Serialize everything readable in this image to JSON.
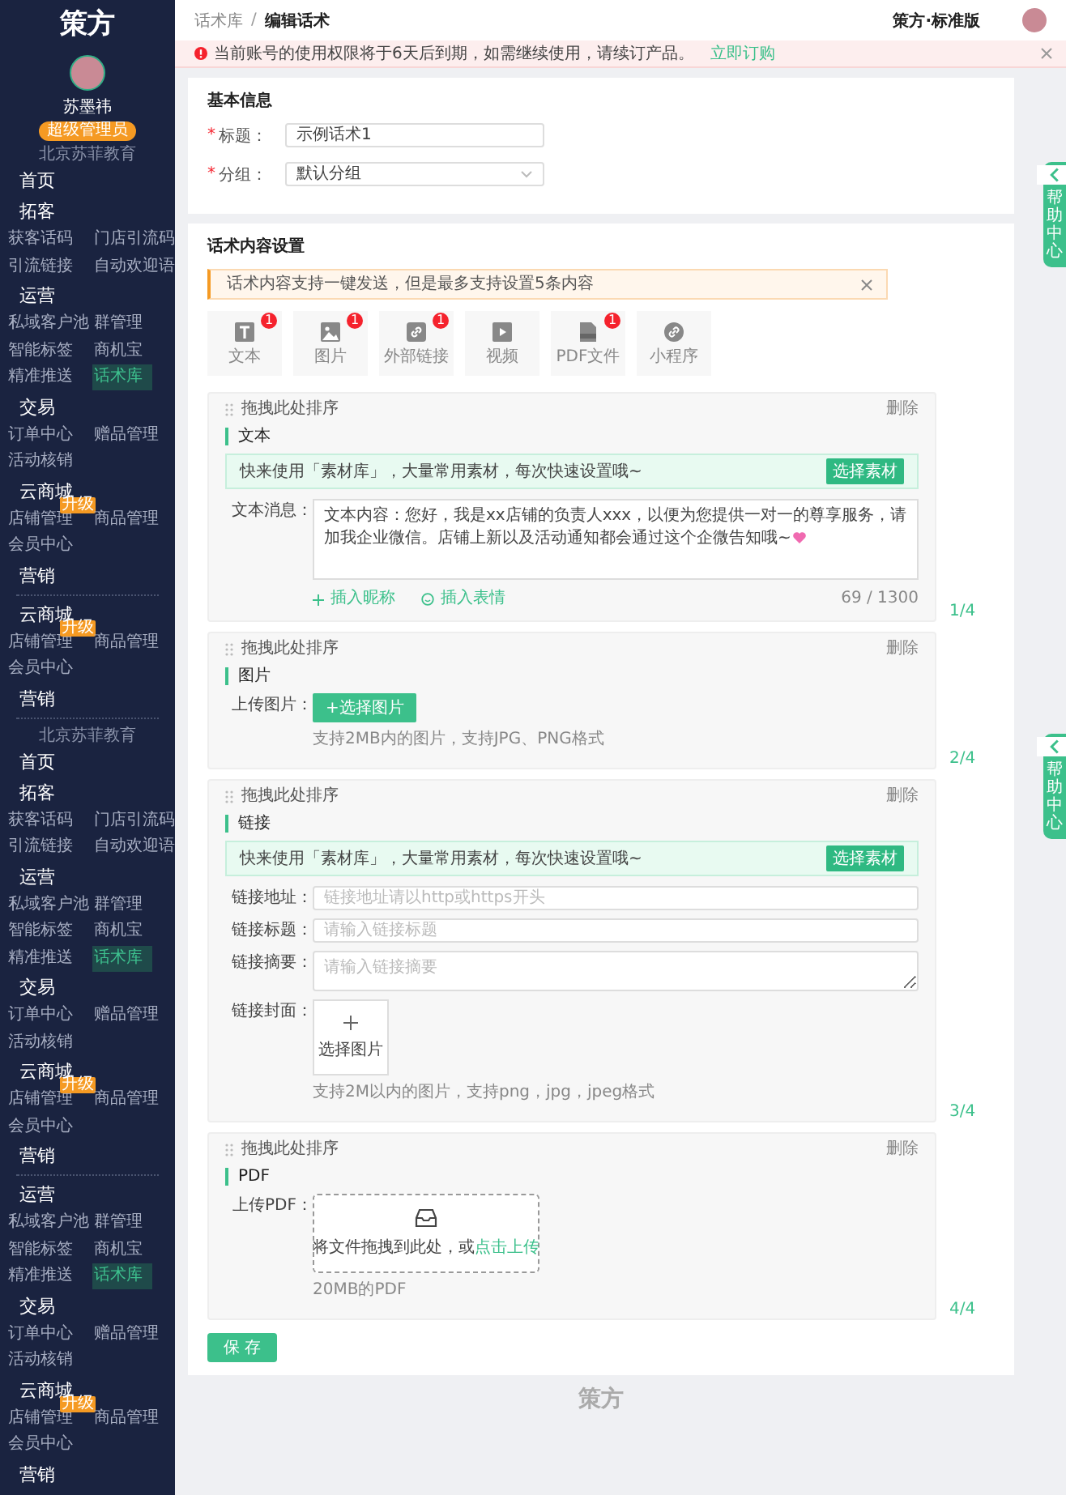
{
  "sidebar": {
    "logo": "策方",
    "user": {
      "name": "苏墨祎",
      "role": "超级管理员",
      "org": "北京苏菲教育"
    },
    "menu": [
      {
        "kind": "section",
        "title": "首页"
      },
      {
        "kind": "section",
        "title": "拓客",
        "items": [
          {
            "label": "获客话码",
            "selected": false
          },
          {
            "label": "门店引流码",
            "selected": false
          },
          {
            "label": "引流链接",
            "selected": false
          },
          {
            "label": "自动欢迎语",
            "selected": false
          }
        ]
      },
      {
        "kind": "section",
        "title": "运营",
        "items": [
          {
            "label": "私域客户池",
            "selected": false
          },
          {
            "label": "群管理",
            "selected": false
          },
          {
            "label": "智能标签",
            "selected": false
          },
          {
            "label": "商机宝",
            "selected": false
          },
          {
            "label": "精准推送",
            "selected": false
          },
          {
            "label": "话术库",
            "selected": true
          }
        ]
      },
      {
        "kind": "section",
        "title": "交易",
        "items": [
          {
            "label": "订单中心",
            "selected": false
          },
          {
            "label": "赠品管理",
            "selected": false
          },
          {
            "label": "活动核销",
            "selected": false
          }
        ]
      },
      {
        "kind": "section",
        "title": "云商城",
        "items": [
          {
            "label": "店铺管理",
            "selected": false,
            "badge": "升级"
          },
          {
            "label": "商品管理",
            "selected": false
          },
          {
            "label": "会员中心",
            "selected": false
          }
        ]
      },
      {
        "kind": "section",
        "title": "营销"
      },
      {
        "kind": "rule"
      },
      {
        "kind": "section",
        "title": "云商城",
        "items": [
          {
            "label": "店铺管理",
            "selected": false,
            "badge": "升级"
          },
          {
            "label": "商品管理",
            "selected": false
          },
          {
            "label": "会员中心",
            "selected": false
          }
        ]
      },
      {
        "kind": "section",
        "title": "营销"
      },
      {
        "kind": "rule"
      },
      {
        "kind": "org",
        "text": "北京苏菲教育"
      },
      {
        "kind": "section",
        "title": "首页"
      },
      {
        "kind": "section",
        "title": "拓客",
        "items": [
          {
            "label": "获客话码",
            "selected": false
          },
          {
            "label": "门店引流码",
            "selected": false
          },
          {
            "label": "引流链接",
            "selected": false
          },
          {
            "label": "自动欢迎语",
            "selected": false
          }
        ]
      },
      {
        "kind": "section",
        "title": "运营",
        "items": [
          {
            "label": "私域客户池",
            "selected": false
          },
          {
            "label": "群管理",
            "selected": false
          },
          {
            "label": "智能标签",
            "selected": false
          },
          {
            "label": "商机宝",
            "selected": false
          },
          {
            "label": "精准推送",
            "selected": false
          },
          {
            "label": "话术库",
            "selected": true
          }
        ]
      },
      {
        "kind": "section",
        "title": "交易",
        "items": [
          {
            "label": "订单中心",
            "selected": false
          },
          {
            "label": "赠品管理",
            "selected": false
          },
          {
            "label": "活动核销",
            "selected": false
          }
        ]
      },
      {
        "kind": "section",
        "title": "云商城",
        "items": [
          {
            "label": "店铺管理",
            "selected": false,
            "badge": "升级"
          },
          {
            "label": "商品管理",
            "selected": false
          },
          {
            "label": "会员中心",
            "selected": false
          }
        ]
      },
      {
        "kind": "section",
        "title": "营销"
      },
      {
        "kind": "rule"
      },
      {
        "kind": "section",
        "title": "运营",
        "items": [
          {
            "label": "私域客户池",
            "selected": false
          },
          {
            "label": "群管理",
            "selected": false
          },
          {
            "label": "智能标签",
            "selected": false
          },
          {
            "label": "商机宝",
            "selected": false
          },
          {
            "label": "精准推送",
            "selected": false
          },
          {
            "label": "话术库",
            "selected": true
          }
        ]
      },
      {
        "kind": "section",
        "title": "交易",
        "items": [
          {
            "label": "订单中心",
            "selected": false
          },
          {
            "label": "赠品管理",
            "selected": false
          },
          {
            "label": "活动核销",
            "selected": false
          }
        ]
      },
      {
        "kind": "section",
        "title": "云商城",
        "items": [
          {
            "label": "店铺管理",
            "selected": false,
            "badge": "升级"
          },
          {
            "label": "商品管理",
            "selected": false
          },
          {
            "label": "会员中心",
            "selected": false
          }
        ]
      },
      {
        "kind": "section",
        "title": "营销"
      }
    ]
  },
  "header": {
    "breadcrumb": [
      "话术库",
      "编辑话术"
    ],
    "separator": "/",
    "edition": "策方·标准版"
  },
  "notice": {
    "text": "当前账号的使用权限将于6天后到期，如需继续使用，请续订产品。",
    "link": "立即订购"
  },
  "help_tabs": [
    {
      "label": "帮助中心"
    },
    {
      "label": "帮助中心"
    }
  ],
  "basic_info": {
    "title": "基本信息",
    "fields": [
      {
        "label": "标题：",
        "required_mark": "*",
        "kind": "input",
        "value": "示例话术1"
      },
      {
        "label": "分组：",
        "required_mark": "*",
        "kind": "select",
        "value": "默认分组"
      }
    ]
  },
  "content": {
    "title": "话术内容设置",
    "tip": "话术内容支持一键发送，但是最多支持设置5条内容",
    "types": [
      {
        "kind": "text",
        "label": "文本",
        "count": "1"
      },
      {
        "kind": "image",
        "label": "图片",
        "count": "1"
      },
      {
        "kind": "link",
        "label": "外部链接",
        "count": "1"
      },
      {
        "kind": "video",
        "label": "视频"
      },
      {
        "kind": "pdf",
        "label": "PDF文件",
        "count": "1"
      },
      {
        "kind": "miniapp",
        "label": "小程序"
      }
    ],
    "blocks": [
      {
        "kind": "text",
        "handle": "拖拽此处排序",
        "delete": "删除",
        "title": "文本",
        "promo": {
          "text": "快来使用「素材库」，大量常用素材，每次快速设置哦~",
          "button": "选择素材"
        },
        "label": "文本消息：",
        "value": "文本内容：您好，我是xx店铺的负责人xxx，以便为您提供一对一的尊享服务，请加我企业微信。店铺上新以及活动通知都会通过这个企微告知哦~",
        "actions": [
          {
            "kind": "plus",
            "label": "插入昵称"
          },
          {
            "kind": "smile",
            "label": "插入表情"
          }
        ],
        "counter": "69 / 1300",
        "index": "1/4"
      },
      {
        "kind": "image",
        "handle": "拖拽此处排序",
        "delete": "删除",
        "title": "图片",
        "label": "上传图片：",
        "button": "+选择图片",
        "hint": "支持2MB内的图片，支持JPG、PNG格式",
        "index": "2/4"
      },
      {
        "kind": "link",
        "handle": "拖拽此处排序",
        "delete": "删除",
        "title": "链接",
        "promo": {
          "text": "快来使用「素材库」，大量常用素材，每次快速设置哦~",
          "button": "选择素材"
        },
        "fields": [
          {
            "label": "链接地址：",
            "placeholder": "链接地址请以http或https开头",
            "multiline": false
          },
          {
            "label": "链接标题：",
            "placeholder": "请输入链接标题",
            "multiline": false
          },
          {
            "label": "链接摘要：",
            "placeholder": "请输入链接摘要",
            "multiline": true
          }
        ],
        "cover": {
          "label": "链接封面：",
          "text": "选择图片"
        },
        "hint": "支持2M以内的图片，支持png，jpg，jpeg格式",
        "index": "3/4"
      },
      {
        "kind": "pdf",
        "handle": "拖拽此处排序",
        "delete": "删除",
        "title": "PDF",
        "label": "上传PDF：",
        "drop_text": "将文件拖拽到此处，或",
        "drop_link": "点击上传",
        "hint": "20MB的PDF",
        "index": "4/4"
      }
    ],
    "save": "保 存"
  },
  "footer": {
    "logo": "策方"
  }
}
